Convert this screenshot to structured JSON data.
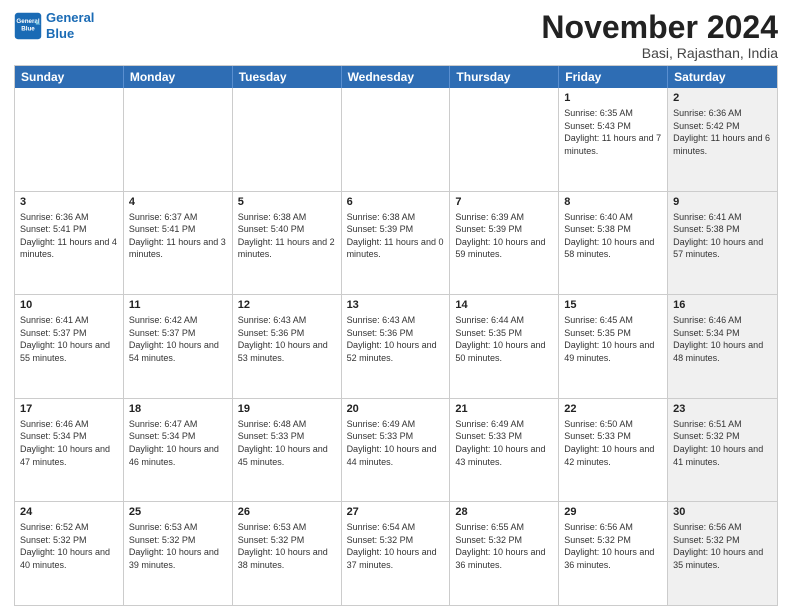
{
  "logo": {
    "line1": "General",
    "line2": "Blue"
  },
  "header": {
    "month": "November 2024",
    "location": "Basi, Rajasthan, India"
  },
  "weekdays": [
    "Sunday",
    "Monday",
    "Tuesday",
    "Wednesday",
    "Thursday",
    "Friday",
    "Saturday"
  ],
  "rows": [
    [
      {
        "day": "",
        "info": "",
        "shaded": false
      },
      {
        "day": "",
        "info": "",
        "shaded": false
      },
      {
        "day": "",
        "info": "",
        "shaded": false
      },
      {
        "day": "",
        "info": "",
        "shaded": false
      },
      {
        "day": "",
        "info": "",
        "shaded": false
      },
      {
        "day": "1",
        "info": "Sunrise: 6:35 AM\nSunset: 5:43 PM\nDaylight: 11 hours and 7 minutes.",
        "shaded": false
      },
      {
        "day": "2",
        "info": "Sunrise: 6:36 AM\nSunset: 5:42 PM\nDaylight: 11 hours and 6 minutes.",
        "shaded": true
      }
    ],
    [
      {
        "day": "3",
        "info": "Sunrise: 6:36 AM\nSunset: 5:41 PM\nDaylight: 11 hours and 4 minutes.",
        "shaded": false
      },
      {
        "day": "4",
        "info": "Sunrise: 6:37 AM\nSunset: 5:41 PM\nDaylight: 11 hours and 3 minutes.",
        "shaded": false
      },
      {
        "day": "5",
        "info": "Sunrise: 6:38 AM\nSunset: 5:40 PM\nDaylight: 11 hours and 2 minutes.",
        "shaded": false
      },
      {
        "day": "6",
        "info": "Sunrise: 6:38 AM\nSunset: 5:39 PM\nDaylight: 11 hours and 0 minutes.",
        "shaded": false
      },
      {
        "day": "7",
        "info": "Sunrise: 6:39 AM\nSunset: 5:39 PM\nDaylight: 10 hours and 59 minutes.",
        "shaded": false
      },
      {
        "day": "8",
        "info": "Sunrise: 6:40 AM\nSunset: 5:38 PM\nDaylight: 10 hours and 58 minutes.",
        "shaded": false
      },
      {
        "day": "9",
        "info": "Sunrise: 6:41 AM\nSunset: 5:38 PM\nDaylight: 10 hours and 57 minutes.",
        "shaded": true
      }
    ],
    [
      {
        "day": "10",
        "info": "Sunrise: 6:41 AM\nSunset: 5:37 PM\nDaylight: 10 hours and 55 minutes.",
        "shaded": false
      },
      {
        "day": "11",
        "info": "Sunrise: 6:42 AM\nSunset: 5:37 PM\nDaylight: 10 hours and 54 minutes.",
        "shaded": false
      },
      {
        "day": "12",
        "info": "Sunrise: 6:43 AM\nSunset: 5:36 PM\nDaylight: 10 hours and 53 minutes.",
        "shaded": false
      },
      {
        "day": "13",
        "info": "Sunrise: 6:43 AM\nSunset: 5:36 PM\nDaylight: 10 hours and 52 minutes.",
        "shaded": false
      },
      {
        "day": "14",
        "info": "Sunrise: 6:44 AM\nSunset: 5:35 PM\nDaylight: 10 hours and 50 minutes.",
        "shaded": false
      },
      {
        "day": "15",
        "info": "Sunrise: 6:45 AM\nSunset: 5:35 PM\nDaylight: 10 hours and 49 minutes.",
        "shaded": false
      },
      {
        "day": "16",
        "info": "Sunrise: 6:46 AM\nSunset: 5:34 PM\nDaylight: 10 hours and 48 minutes.",
        "shaded": true
      }
    ],
    [
      {
        "day": "17",
        "info": "Sunrise: 6:46 AM\nSunset: 5:34 PM\nDaylight: 10 hours and 47 minutes.",
        "shaded": false
      },
      {
        "day": "18",
        "info": "Sunrise: 6:47 AM\nSunset: 5:34 PM\nDaylight: 10 hours and 46 minutes.",
        "shaded": false
      },
      {
        "day": "19",
        "info": "Sunrise: 6:48 AM\nSunset: 5:33 PM\nDaylight: 10 hours and 45 minutes.",
        "shaded": false
      },
      {
        "day": "20",
        "info": "Sunrise: 6:49 AM\nSunset: 5:33 PM\nDaylight: 10 hours and 44 minutes.",
        "shaded": false
      },
      {
        "day": "21",
        "info": "Sunrise: 6:49 AM\nSunset: 5:33 PM\nDaylight: 10 hours and 43 minutes.",
        "shaded": false
      },
      {
        "day": "22",
        "info": "Sunrise: 6:50 AM\nSunset: 5:33 PM\nDaylight: 10 hours and 42 minutes.",
        "shaded": false
      },
      {
        "day": "23",
        "info": "Sunrise: 6:51 AM\nSunset: 5:32 PM\nDaylight: 10 hours and 41 minutes.",
        "shaded": true
      }
    ],
    [
      {
        "day": "24",
        "info": "Sunrise: 6:52 AM\nSunset: 5:32 PM\nDaylight: 10 hours and 40 minutes.",
        "shaded": false
      },
      {
        "day": "25",
        "info": "Sunrise: 6:53 AM\nSunset: 5:32 PM\nDaylight: 10 hours and 39 minutes.",
        "shaded": false
      },
      {
        "day": "26",
        "info": "Sunrise: 6:53 AM\nSunset: 5:32 PM\nDaylight: 10 hours and 38 minutes.",
        "shaded": false
      },
      {
        "day": "27",
        "info": "Sunrise: 6:54 AM\nSunset: 5:32 PM\nDaylight: 10 hours and 37 minutes.",
        "shaded": false
      },
      {
        "day": "28",
        "info": "Sunrise: 6:55 AM\nSunset: 5:32 PM\nDaylight: 10 hours and 36 minutes.",
        "shaded": false
      },
      {
        "day": "29",
        "info": "Sunrise: 6:56 AM\nSunset: 5:32 PM\nDaylight: 10 hours and 36 minutes.",
        "shaded": false
      },
      {
        "day": "30",
        "info": "Sunrise: 6:56 AM\nSunset: 5:32 PM\nDaylight: 10 hours and 35 minutes.",
        "shaded": true
      }
    ]
  ]
}
